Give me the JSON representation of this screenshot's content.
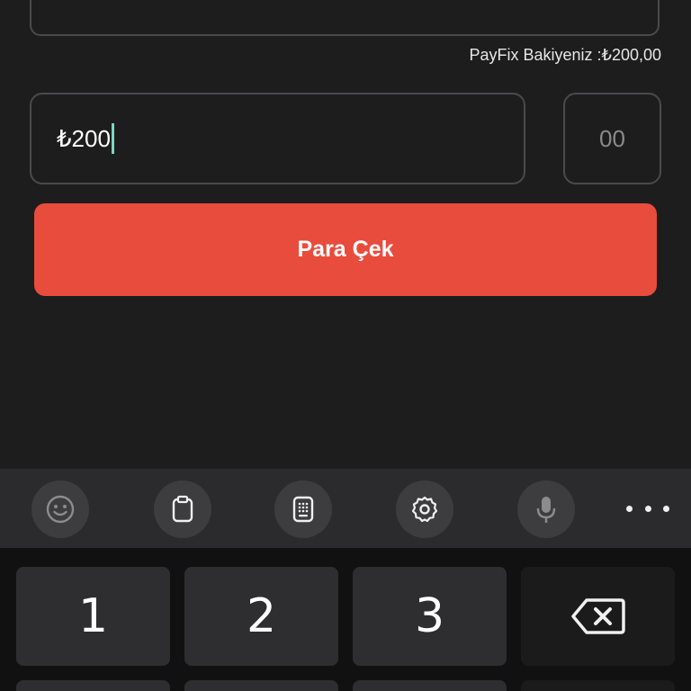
{
  "form": {
    "balance_text": "PayFix Bakiyeniz :₺200,00",
    "amount_value": "₺200",
    "cents_value": "00",
    "submit_label": "Para Çek",
    "accent_color": "#e84c3d"
  },
  "keyboard": {
    "toolbar": {
      "items": [
        "emoji-icon",
        "clipboard-icon",
        "keyboard-layout-icon",
        "settings-icon",
        "microphone-icon",
        "more-icon"
      ]
    },
    "keys": {
      "k1": "1",
      "k2": "2",
      "k3": "3",
      "backspace": "backspace-icon"
    }
  }
}
